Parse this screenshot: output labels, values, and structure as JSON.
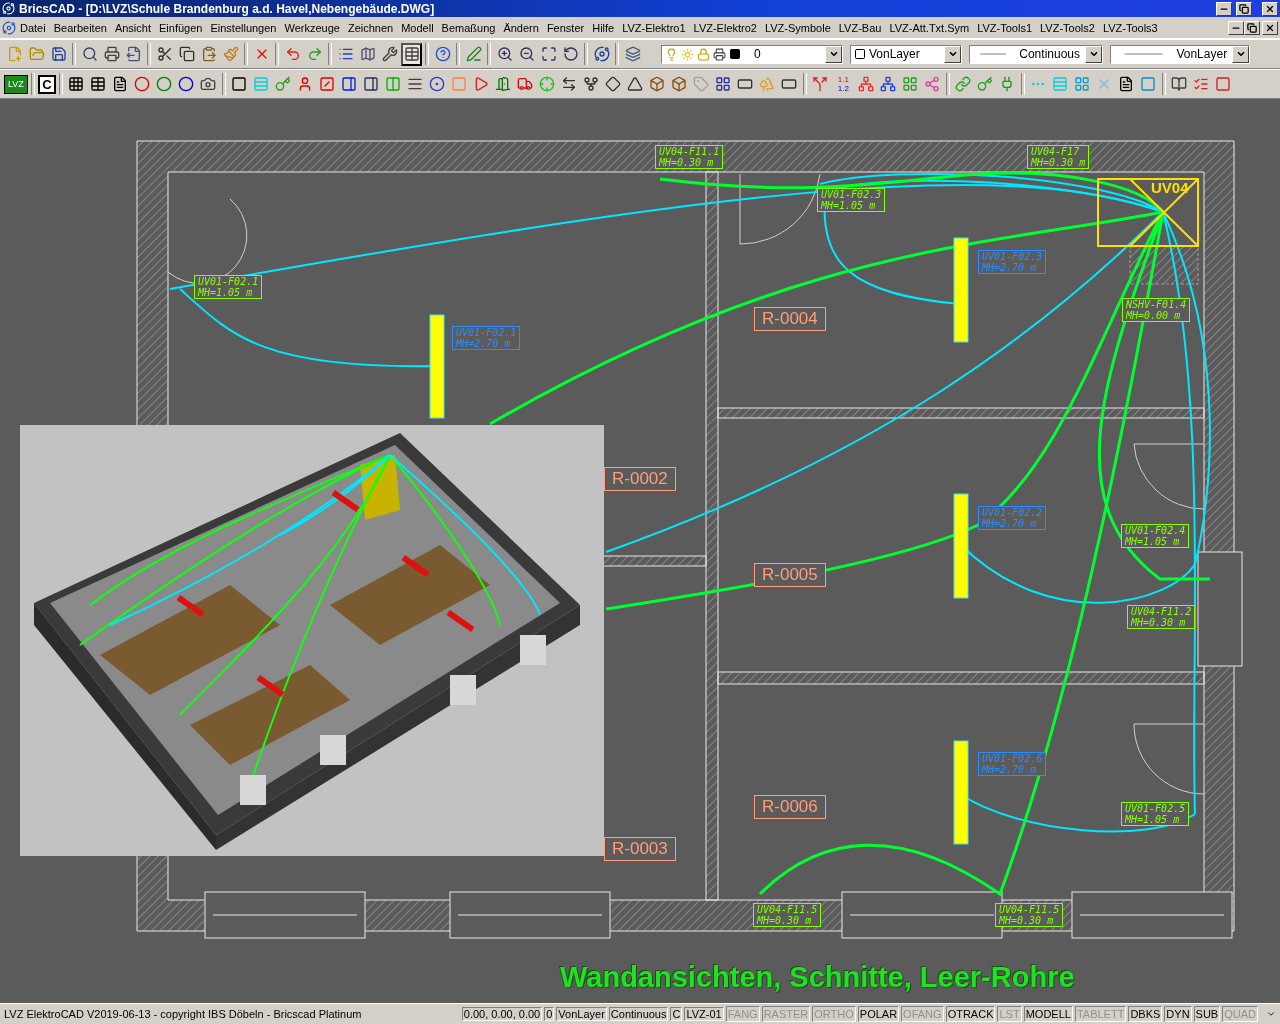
{
  "window": {
    "title": "BricsCAD - [D:\\LVZ\\Schule Brandenburg a.d. Havel,Nebengebäude.DWG]"
  },
  "menu": [
    "Datei",
    "Bearbeiten",
    "Ansicht",
    "Einfügen",
    "Einstellungen",
    "Werkzeuge",
    "Zeichnen",
    "Modell",
    "Bemaßung",
    "Ändern",
    "Fenster",
    "Hilfe",
    "LVZ-Elektro1",
    "LVZ-Elektro2",
    "LVZ-Symbole",
    "LVZ-Bau",
    "LVZ-Att.Txt.Sym",
    "LVZ-Tools1",
    "LVZ-Tools2",
    "LVZ-Tools3"
  ],
  "properties_toolbar": {
    "layer": "0",
    "color_setting": "VonLayer",
    "linetype": "Continuous",
    "lineweight": "VonLayer"
  },
  "lvz_toolbar": {
    "logo": "LVZ",
    "c_button": "C",
    "numbering": [
      "1.1",
      "1.2"
    ]
  },
  "drawing": {
    "distributor": "UV04",
    "rooms": [
      "R-0004",
      "R-0002",
      "R-0005",
      "R-0006",
      "R-0003"
    ],
    "annotations": [
      {
        "kind": "socket",
        "lines": [
          "UV04-F11.1",
          "MH=0.30 m"
        ]
      },
      {
        "kind": "socket",
        "lines": [
          "UV04-F17",
          "MH=0.30 m"
        ]
      },
      {
        "kind": "socket",
        "lines": [
          "UV01-F02.3",
          "MH=1.05 m"
        ]
      },
      {
        "kind": "lamp",
        "lines": [
          "UV01-F02.3",
          "MH=2.70 m"
        ]
      },
      {
        "kind": "socket",
        "lines": [
          "NSHV-F01.4",
          "MH=0.00 m"
        ]
      },
      {
        "kind": "socket",
        "lines": [
          "UV01-F02.1",
          "MH=1.05 m"
        ]
      },
      {
        "kind": "lamp",
        "lines": [
          "UV01-F02.1",
          "MH=2.70 m"
        ]
      },
      {
        "kind": "lamp",
        "lines": [
          "UV01-F02.2",
          "MH=2.70 m"
        ]
      },
      {
        "kind": "socket",
        "lines": [
          "UV01-F02.4",
          "MH=1.05 m"
        ]
      },
      {
        "kind": "socket",
        "lines": [
          "UV04-F11.2",
          "MH=0.30 m"
        ]
      },
      {
        "kind": "lamp",
        "lines": [
          "UV01-F02.6",
          "MH=2.70 m"
        ]
      },
      {
        "kind": "socket",
        "lines": [
          "UV01-F02.5",
          "MH=1.05 m"
        ]
      },
      {
        "kind": "socket",
        "lines": [
          "UV04-F11.5",
          "MH=0.30 m"
        ]
      },
      {
        "kind": "socket",
        "lines": [
          "UV04-F11.5",
          "MH=0.30 m"
        ]
      }
    ],
    "caption": "Wandansichten, Schnitte, Leer-Rohre"
  },
  "status_bar": {
    "text": "LVZ ElektroCAD V2019-06-13 - copyright IBS Döbeln - Bricscad Platinum",
    "fields": [
      "0.00, 0.00, 0.00",
      "0",
      "VonLayer",
      "Continuous",
      "C",
      "LVZ-01"
    ],
    "toggles": [
      {
        "label": "FANG",
        "on": false
      },
      {
        "label": "RASTER",
        "on": false
      },
      {
        "label": "ORTHO",
        "on": false
      },
      {
        "label": "POLAR",
        "on": true
      },
      {
        "label": "OFANG",
        "on": false
      },
      {
        "label": "OTRACK",
        "on": true
      },
      {
        "label": "LST",
        "on": false
      },
      {
        "label": "MODELL",
        "on": true
      },
      {
        "label": "TABLETT",
        "on": false
      },
      {
        "label": "DBKS",
        "on": true
      },
      {
        "label": "DYN",
        "on": true
      },
      {
        "label": "SUB",
        "on": true
      },
      {
        "label": "QUAD",
        "on": false
      }
    ]
  }
}
